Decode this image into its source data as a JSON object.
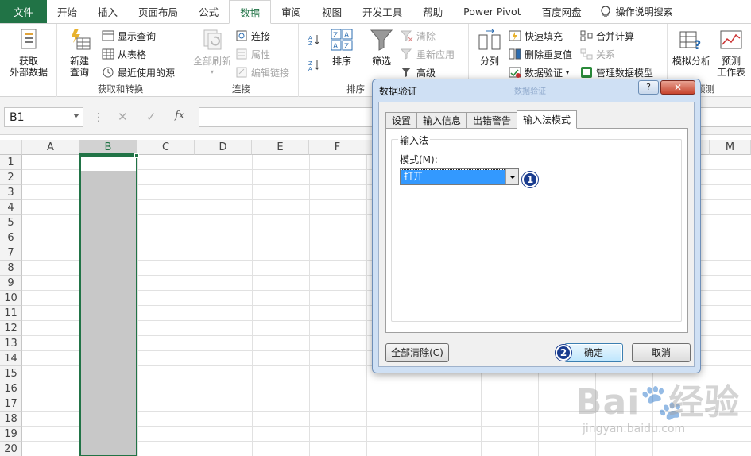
{
  "menu": {
    "tabs": [
      "文件",
      "开始",
      "插入",
      "页面布局",
      "公式",
      "数据",
      "审阅",
      "视图",
      "开发工具",
      "帮助",
      "Power Pivot",
      "百度网盘"
    ],
    "active_index": 5,
    "tell_me": "操作说明搜索"
  },
  "ribbon": {
    "get_data": {
      "line1": "获取",
      "line2": "外部数据"
    },
    "new_query": {
      "line1": "新建",
      "line2": "查询"
    },
    "show_query": "显示查询",
    "from_table": "从表格",
    "recent_sources": "最近使用的源",
    "group_get_transform": "获取和转换",
    "refresh_all": "全部刷新",
    "connections": "连接",
    "properties": "属性",
    "edit_links": "编辑链接",
    "group_connections": "连接",
    "sort": "排序",
    "filter": "筛选",
    "clear": "清除",
    "reapply": "重新应用",
    "advanced": "高级",
    "group_sort_filter": "排序",
    "text_to_columns": "分列",
    "flash_fill": "快速填充",
    "remove_duplicates": "删除重复值",
    "data_validation": "数据验证",
    "consolidate": "合并计算",
    "relationships": "关系",
    "manage_model": "管理数据模型",
    "what_if": "模拟分析",
    "forecast": {
      "line1": "预测",
      "line2": "工作表"
    },
    "group_forecast": "预测"
  },
  "formula_bar": {
    "name_box": "B1",
    "fx": "fx",
    "cancel": "✕",
    "enter": "✓"
  },
  "grid": {
    "columns": [
      "A",
      "B",
      "C",
      "D",
      "E",
      "F",
      "M"
    ],
    "rows": [
      "1",
      "2",
      "3",
      "4",
      "5",
      "6",
      "7",
      "8",
      "9",
      "10",
      "11",
      "12",
      "13",
      "14",
      "15",
      "16",
      "17",
      "18",
      "19",
      "20"
    ]
  },
  "dialog": {
    "title": "数据验证",
    "ghost_title": "数据验证",
    "help": "?",
    "close": "✕",
    "tabs": [
      "设置",
      "输入信息",
      "出错警告",
      "输入法模式"
    ],
    "active_tab": 3,
    "group_label": "输入法",
    "mode_label": "模式(M):",
    "mode_value": "打开",
    "clear_all": "全部清除(C)",
    "ok": "确定",
    "cancel": "取消",
    "badge1": "1",
    "badge2": "2"
  },
  "watermark": {
    "brand": "Bai",
    "brand2": "经验",
    "url": "jingyan.baidu.com"
  }
}
